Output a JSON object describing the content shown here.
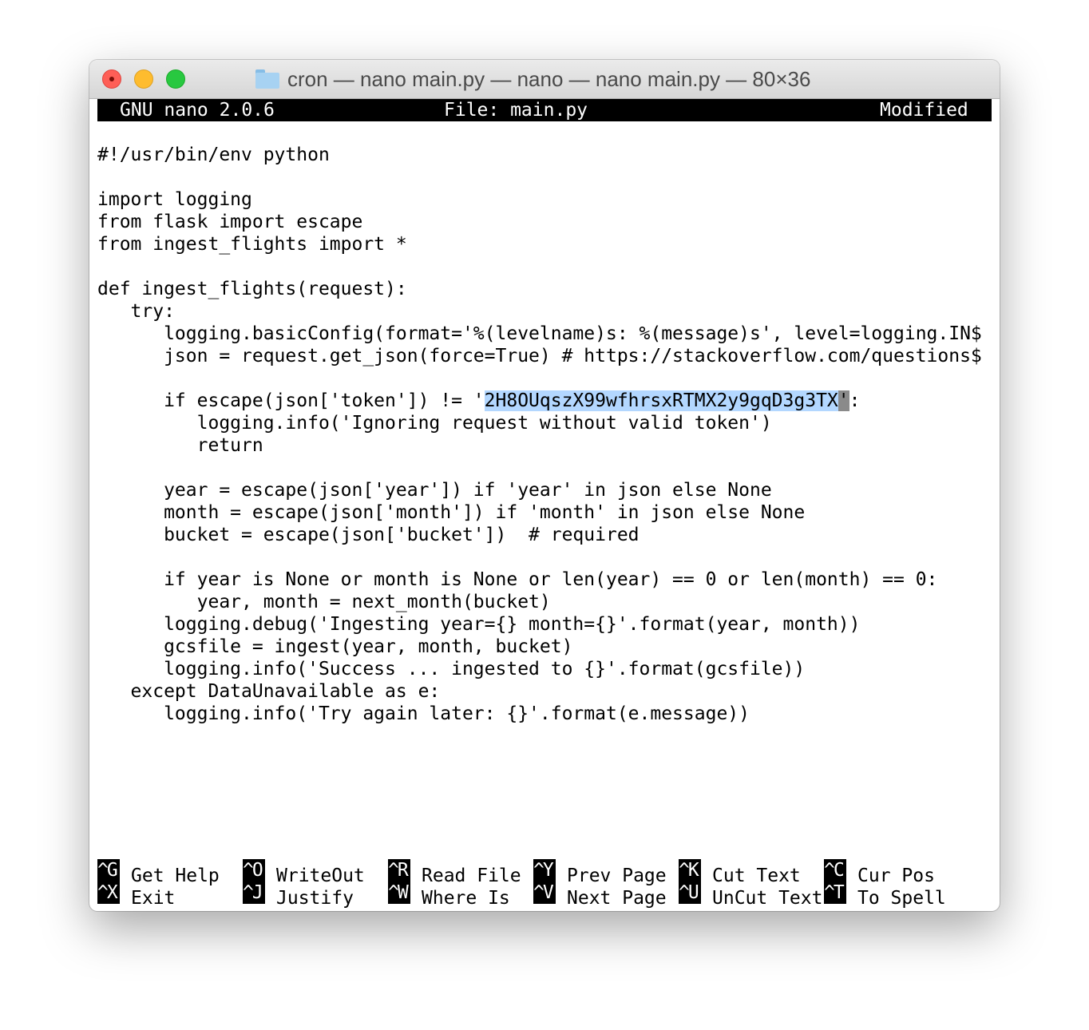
{
  "window": {
    "title": "cron — nano main.py — nano — nano main.py — 80×36",
    "folder_icon": "folder-icon"
  },
  "nano": {
    "version": "GNU nano 2.0.6",
    "file": "File: main.py",
    "state": "Modified"
  },
  "code_lines": [
    "#!/usr/bin/env python",
    "",
    "import logging",
    "from flask import escape",
    "from ingest_flights import *",
    "",
    "def ingest_flights(request):",
    "   try:",
    "      logging.basicConfig(format='%(levelname)s: %(message)s', level=logging.IN$",
    "      json = request.get_json(force=True) # https://stackoverflow.com/questions$",
    "",
    "",
    "         logging.info('Ignoring request without valid token')",
    "         return",
    "",
    "      year = escape(json['year']) if 'year' in json else None",
    "      month = escape(json['month']) if 'month' in json else None",
    "      bucket = escape(json['bucket'])  # required",
    "",
    "      if year is None or month is None or len(year) == 0 or len(month) == 0:",
    "         year, month = next_month(bucket)",
    "      logging.debug('Ingesting year={} month={}'.format(year, month))",
    "      gcsfile = ingest(year, month, bucket)",
    "      logging.info('Success ... ingested to {}'.format(gcsfile))",
    "   except DataUnavailable as e:",
    "      logging.info('Try again later: {}'.format(e.message))"
  ],
  "token_line": {
    "prefix": "      if escape(json['token']) != '",
    "selected": "2H8OUqszX99wfhrsxRTMX2y9gqD3g3TX",
    "cursor": "'",
    "suffix": ":"
  },
  "shortcuts": [
    {
      "key": "^G",
      "label": "Get Help"
    },
    {
      "key": "^O",
      "label": "WriteOut"
    },
    {
      "key": "^R",
      "label": "Read File"
    },
    {
      "key": "^Y",
      "label": "Prev Page"
    },
    {
      "key": "^K",
      "label": "Cut Text"
    },
    {
      "key": "^C",
      "label": "Cur Pos"
    },
    {
      "key": "^X",
      "label": "Exit"
    },
    {
      "key": "^J",
      "label": "Justify"
    },
    {
      "key": "^W",
      "label": "Where Is"
    },
    {
      "key": "^V",
      "label": "Next Page"
    },
    {
      "key": "^U",
      "label": "UnCut Text"
    },
    {
      "key": "^T",
      "label": "To Spell"
    }
  ],
  "colors": {
    "selection": "#b3d7ff",
    "cursor": "#8a8a8a",
    "close": "#fe5f57",
    "minimize": "#febc2e",
    "maximize": "#28c840"
  }
}
